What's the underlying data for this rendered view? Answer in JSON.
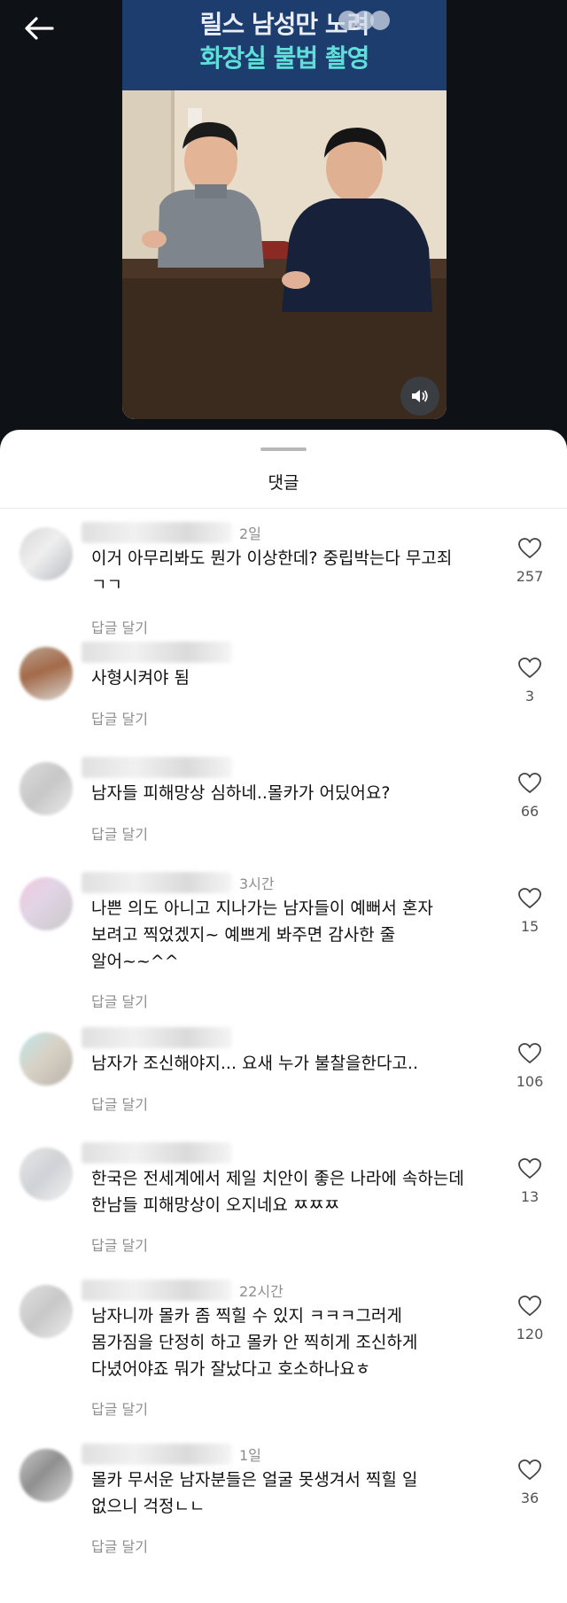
{
  "video": {
    "overlay_title_line1": "릴스 남성만 노려",
    "overlay_title_line2": "화장실 불법 촬영"
  },
  "sheet": {
    "title": "댓글"
  },
  "comments": [
    {
      "time": "2일",
      "text": "이거 아무리봐도 뭔가 이상한데? 중립박는다 무고죄\nㄱㄱ",
      "reply_label": "답글 달기",
      "likes": "257"
    },
    {
      "time": "",
      "text": "사형시켜야 됨",
      "reply_label": "답글 달기",
      "likes": "3"
    },
    {
      "time": "",
      "text": "남자들 피해망상 심하네..몰카가 어딨어요?",
      "reply_label": "답글 달기",
      "likes": "66"
    },
    {
      "time": "3시간",
      "text": "나쁜 의도 아니고 지나가는 남자들이 예뻐서 혼자\n보려고 찍었겠지~ 예쁘게 봐주면 감사한 줄\n알어~~^^",
      "reply_label": "답글 달기",
      "likes": "15"
    },
    {
      "time": "",
      "text": "남자가 조신해야지... 요새 누가 불찰을한다고..",
      "reply_label": "답글 달기",
      "likes": "106"
    },
    {
      "time": "",
      "text": "한국은 전세계에서 제일 치안이 좋은 나라에 속하는데\n한남들 피해망상이 오지네요 ㅉㅉㅉ",
      "reply_label": "답글 달기",
      "likes": "13"
    },
    {
      "time": "22시간",
      "text": "남자니까 몰카 좀 찍힐 수 있지 ㅋㅋㅋ그러게\n몸가짐을 단정히 하고 몰카 안 찍히게 조신하게\n다녔어야죠 뭐가 잘났다고  호소하나요ㅎ",
      "reply_label": "답글 달기",
      "likes": "120"
    },
    {
      "time": "1일",
      "text": "몰카 무서운 남자분들은 얼굴 못생겨서 찍힐 일\n없으니 걱정ㄴㄴ",
      "reply_label": "답글 달기",
      "likes": "36"
    }
  ],
  "colors": {
    "background": "#0e1216",
    "video_band": "#1e3d6f",
    "title_accent": "#5ee0d8",
    "sheet": "#ffffff",
    "secondary_text": "#8e8e8e"
  },
  "icons": [
    "back-arrow-icon",
    "sound-icon",
    "heart-icon"
  ]
}
